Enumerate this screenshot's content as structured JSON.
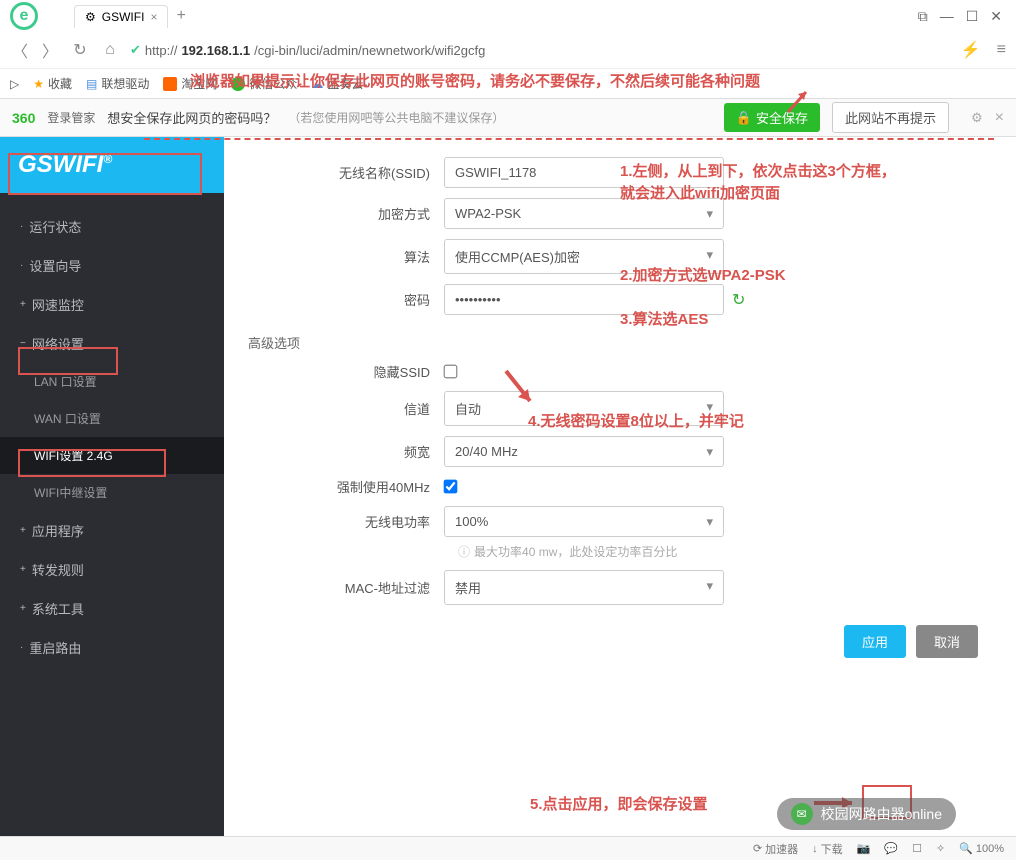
{
  "browser": {
    "tab_title": "GSWIFI",
    "url_prefix": "http://",
    "url_host": "192.168.1.1",
    "url_path": "/cgi-bin/luci/admin/newnetwork/wifi2gcfg",
    "fav_label": "收藏",
    "fav_items": [
      "联想驱动",
      "淘宝网",
      "微信公众",
      "蓝奏云-"
    ]
  },
  "pm": {
    "logo": "360",
    "logo_sub": "登录管家",
    "text": "想安全保存此网页的密码吗？",
    "note": "（若您使用网吧等公共电脑不建议保存）",
    "save": "安全保存",
    "dismiss": "此网站不再提示"
  },
  "annotations": {
    "top": "浏览器如果提示让你保存此网页的账号密码，请务必不要保存，不然后续可能各种问题",
    "a1a": "1.左侧，从上到下，依次点击这3个方框，",
    "a1b": "就会进入此wifi加密页面",
    "a2": "2.加密方式选WPA2-PSK",
    "a3": "3.算法选AES",
    "a4": "4.无线密码设置8位以上，并牢记",
    "a5": "5.点击应用，即会保存设置"
  },
  "sidebar": {
    "logo": "GSWIFI",
    "logo_sup": "®",
    "items": [
      {
        "label": "运行状态",
        "pre": "·"
      },
      {
        "label": "设置向导",
        "pre": "·"
      },
      {
        "label": "网速监控",
        "pre": "+"
      },
      {
        "label": "网络设置",
        "pre": "−"
      },
      {
        "label": "LAN 口设置",
        "pre": "",
        "sub": true
      },
      {
        "label": "WAN 口设置",
        "pre": "",
        "sub": true
      },
      {
        "label": "WIFI设置 2.4G",
        "pre": "",
        "sub": true,
        "active": true
      },
      {
        "label": "WIFI中继设置",
        "pre": "",
        "sub": true
      },
      {
        "label": "应用程序",
        "pre": "+"
      },
      {
        "label": "转发规则",
        "pre": "+"
      },
      {
        "label": "系统工具",
        "pre": "+"
      },
      {
        "label": "重启路由",
        "pre": "·"
      }
    ]
  },
  "form": {
    "ssid_label": "无线名称(SSID)",
    "ssid_value": "GSWIFI_1178",
    "enc_label": "加密方式",
    "enc_value": "WPA2-PSK",
    "algo_label": "算法",
    "algo_value": "使用CCMP(AES)加密",
    "pwd_label": "密码",
    "pwd_value": "••••••••••",
    "adv_title": "高级选项",
    "hide_label": "隐藏SSID",
    "chan_label": "信道",
    "chan_value": "自动",
    "bw_label": "频宽",
    "bw_value": "20/40 MHz",
    "force40_label": "强制使用40MHz",
    "power_label": "无线电功率",
    "power_value": "100%",
    "power_hint": "最大功率40 mw，此处设定功率百分比",
    "mac_label": "MAC-地址过滤",
    "mac_value": "禁用",
    "btn_apply": "应用",
    "btn_cancel": "取消"
  },
  "status": {
    "accel": "加速器",
    "down": "下载",
    "zoom": "100%"
  },
  "watermark": "校园网路由器online"
}
